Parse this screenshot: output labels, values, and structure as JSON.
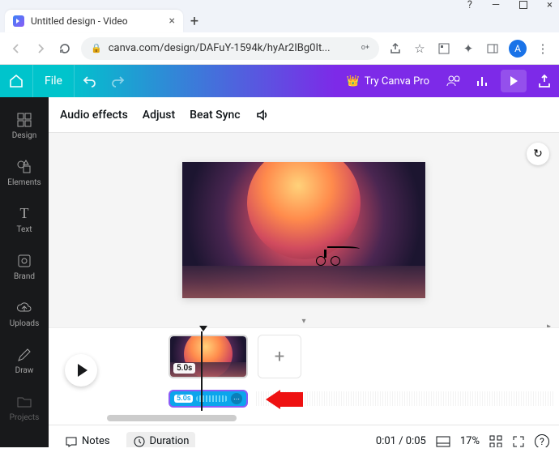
{
  "window": {
    "tab_title": "Untitled design - Video",
    "url": "canva.com/design/DAFuY-1594k/hyAr2IBg0It..."
  },
  "browser": {
    "avatar_letter": "A"
  },
  "topbar": {
    "file": "File",
    "cta": "Try Canva Pro"
  },
  "sidebar": {
    "items": [
      {
        "label": "Design"
      },
      {
        "label": "Elements"
      },
      {
        "label": "Text"
      },
      {
        "label": "Brand"
      },
      {
        "label": "Uploads"
      },
      {
        "label": "Draw"
      },
      {
        "label": "Projects"
      }
    ]
  },
  "toolbar": {
    "audio_effects": "Audio effects",
    "adjust": "Adjust",
    "beat_sync": "Beat Sync"
  },
  "timeline": {
    "clip_duration": "5.0s",
    "audio_duration": "5.0s"
  },
  "footer": {
    "notes": "Notes",
    "duration": "Duration",
    "time": "0:01 / 0:05",
    "zoom": "17%"
  }
}
